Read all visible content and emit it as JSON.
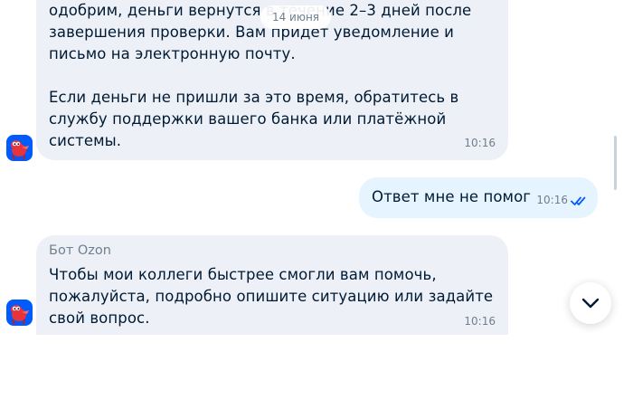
{
  "date_divider": "14 июня",
  "messages": [
    {
      "direction": "incoming",
      "text": "одобрим, деньги вернутся в течение 2–3 дней после\nзавершения проверки. Вам придет уведомление и\nписьмо на электронную почту.\n\nЕсли деньги не пришли за это время, обратитесь в\nслужбу поддержки вашего банка или платёжной\nсистемы.",
      "time": "10:16",
      "avatar_icon": "ozon-bot-mascot-icon"
    },
    {
      "direction": "outgoing",
      "text": "Ответ мне не помог",
      "time": "10:16",
      "status_icon": "double-check-icon"
    },
    {
      "direction": "incoming",
      "sender": "Бот Ozon",
      "text": "Чтобы мои коллеги быстрее смогли вам помочь,\nпожалуйста, подробно опишите ситуацию или задайте\nсвой вопрос.",
      "time": "10:16",
      "avatar_icon": "ozon-bot-mascot-icon"
    }
  ],
  "scroll_button_icon": "chevron-down-icon",
  "colors": {
    "incoming_bubble": "#edf1f7",
    "outgoing_bubble": "#e5f4ff",
    "text": "#001a34",
    "meta_text": "#707f8d",
    "brand_blue": "#005bff",
    "check_blue": "#005bff",
    "mascot_red": "#e8323c"
  }
}
